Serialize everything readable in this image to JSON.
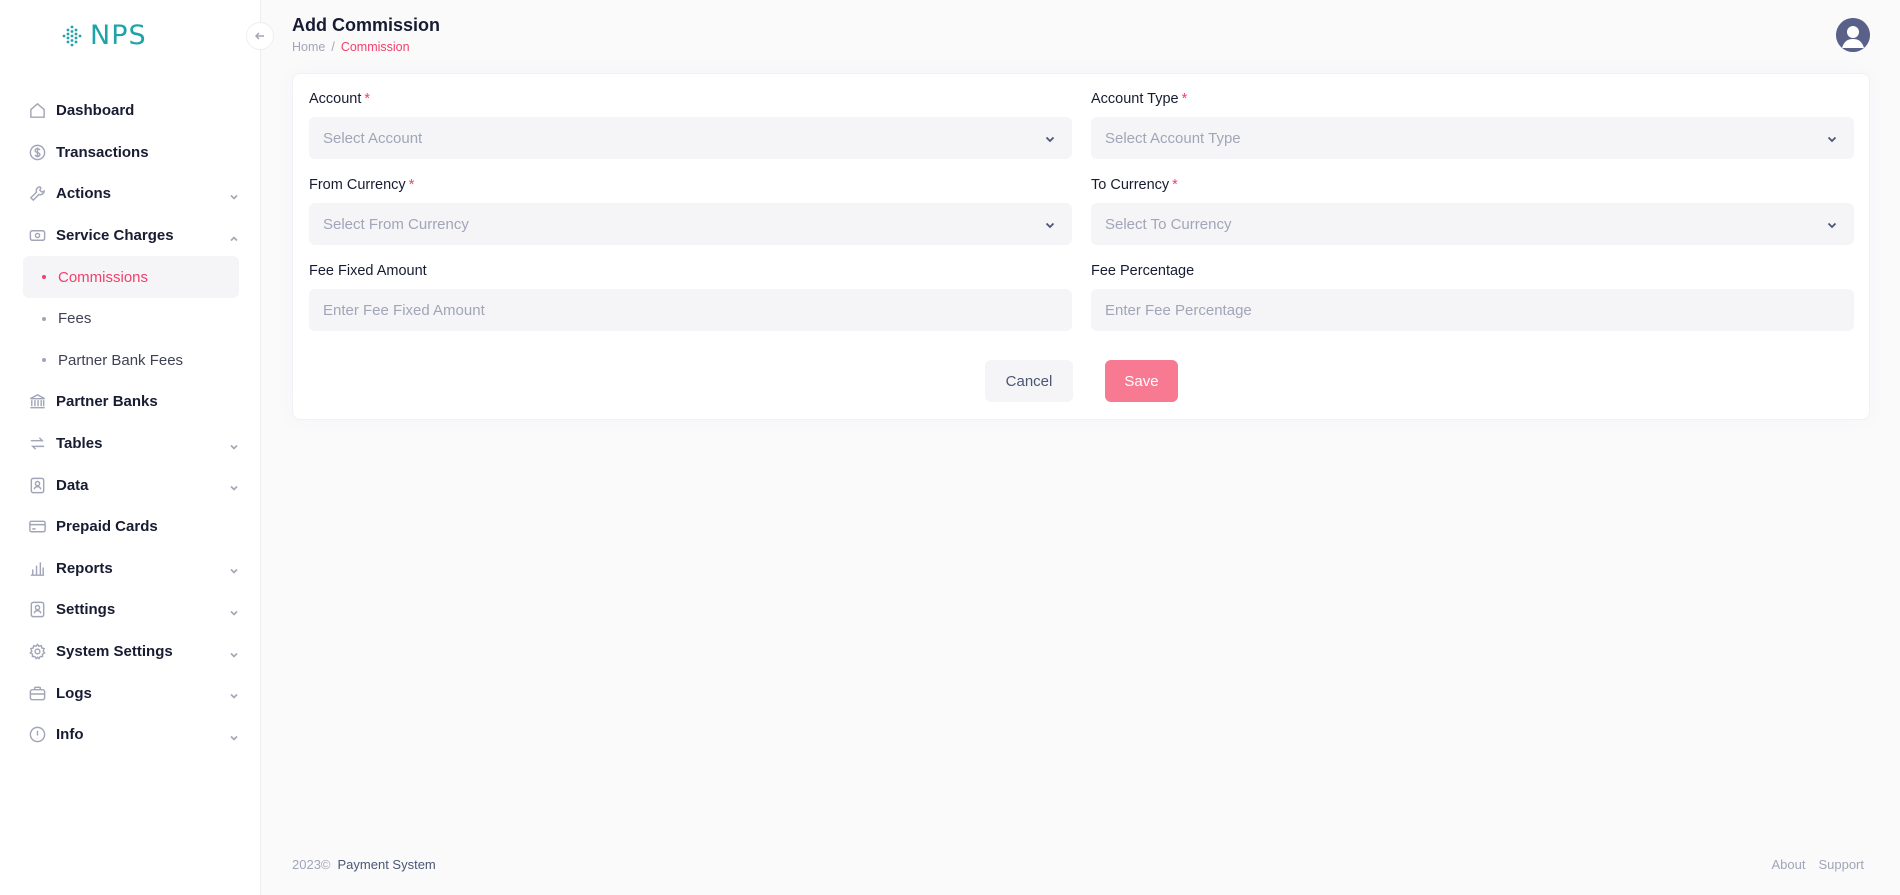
{
  "app": {
    "logo_text": "NPS"
  },
  "sidebar": {
    "items": [
      {
        "label": "Dashboard",
        "icon": "home-icon",
        "has_chevron": false
      },
      {
        "label": "Transactions",
        "icon": "dollar-circle-icon",
        "has_chevron": false
      },
      {
        "label": "Actions",
        "icon": "wrench-icon",
        "has_chevron": true
      },
      {
        "label": "Service Charges",
        "icon": "cash-icon",
        "has_chevron": true,
        "expanded": true
      }
    ],
    "sub_items": [
      {
        "label": "Commissions",
        "active": true
      },
      {
        "label": "Fees",
        "active": false
      },
      {
        "label": "Partner Bank Fees",
        "active": false
      }
    ],
    "items_after": [
      {
        "label": "Partner Banks",
        "icon": "bank-icon",
        "has_chevron": false
      },
      {
        "label": "Tables",
        "icon": "arrows-icon",
        "has_chevron": true
      },
      {
        "label": "Data",
        "icon": "profile-icon",
        "has_chevron": true
      },
      {
        "label": "Prepaid Cards",
        "icon": "credit-card-icon",
        "has_chevron": false
      },
      {
        "label": "Reports",
        "icon": "bar-chart-icon",
        "has_chevron": true
      },
      {
        "label": "Settings",
        "icon": "profile-icon",
        "has_chevron": true
      },
      {
        "label": "System Settings",
        "icon": "gear-icon",
        "has_chevron": true
      },
      {
        "label": "Logs",
        "icon": "briefcase-icon",
        "has_chevron": true
      },
      {
        "label": "Info",
        "icon": "info-icon",
        "has_chevron": true
      }
    ]
  },
  "header": {
    "title": "Add Commission",
    "breadcrumb": {
      "home": "Home",
      "separator": "/",
      "current": "Commission"
    }
  },
  "form": {
    "account": {
      "label": "Account",
      "placeholder": "Select Account",
      "required": true
    },
    "account_type": {
      "label": "Account Type",
      "placeholder": "Select Account Type",
      "required": true
    },
    "from_currency": {
      "label": "From Currency",
      "placeholder": "Select From Currency",
      "required": true
    },
    "to_currency": {
      "label": "To Currency",
      "placeholder": "Select To Currency",
      "required": true
    },
    "fee_fixed": {
      "label": "Fee Fixed Amount",
      "placeholder": "Enter Fee Fixed Amount",
      "value": ""
    },
    "fee_percentage": {
      "label": "Fee Percentage",
      "placeholder": "Enter Fee Percentage",
      "value": ""
    },
    "required_mark": "*",
    "cancel_label": "Cancel",
    "save_label": "Save"
  },
  "footer": {
    "year": "2023©",
    "name": "Payment System",
    "links": [
      "About",
      "Support"
    ]
  },
  "colors": {
    "accent": "#f1416c",
    "save_button": "#f87a92",
    "logo": "#1fa2a8"
  }
}
